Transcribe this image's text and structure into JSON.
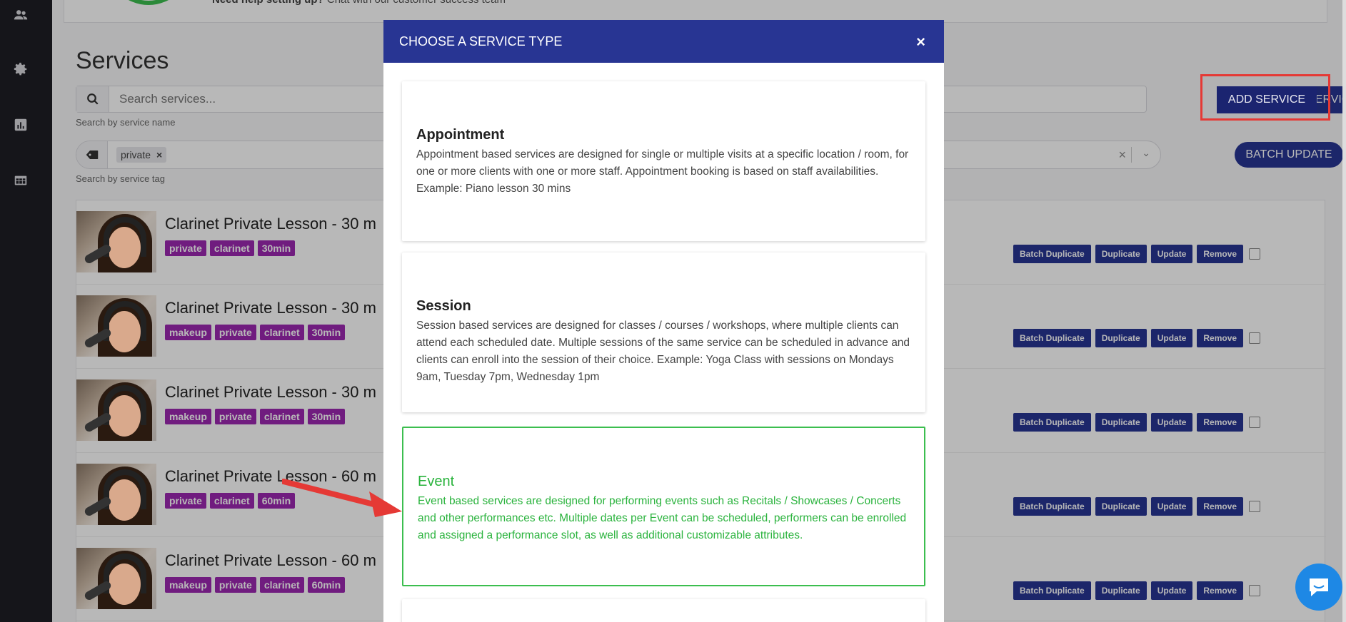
{
  "help": {
    "bold": "Need help setting up?",
    "rest": "Chat with our customer success team"
  },
  "page": {
    "title": "Services"
  },
  "search": {
    "placeholder": "Search services...",
    "hint": "Search by service name"
  },
  "tag_filter": {
    "chip": "private",
    "hint": "Search by service tag"
  },
  "buttons": {
    "add_service": "ADD SERVICE",
    "batch_update": "BATCH UPDATE"
  },
  "services": [
    {
      "title": "Clarinet Private Lesson - 30 m",
      "tags": [
        "private",
        "clarinet",
        "30min"
      ]
    },
    {
      "title": "Clarinet Private Lesson - 30 m",
      "tags": [
        "makeup",
        "private",
        "clarinet",
        "30min"
      ]
    },
    {
      "title": "Clarinet Private Lesson - 30 m",
      "tags": [
        "makeup",
        "private",
        "clarinet",
        "30min"
      ]
    },
    {
      "title": "Clarinet Private Lesson - 60 m",
      "tags": [
        "private",
        "clarinet",
        "60min"
      ]
    },
    {
      "title": "Clarinet Private Lesson - 60 m",
      "tags": [
        "makeup",
        "private",
        "clarinet",
        "60min"
      ]
    }
  ],
  "row_actions": {
    "batch_duplicate": "Batch Duplicate",
    "duplicate": "Duplicate",
    "update": "Update",
    "remove": "Remove"
  },
  "modal": {
    "title": "CHOOSE A SERVICE TYPE",
    "close": "×",
    "types": [
      {
        "name": "Appointment",
        "desc": "Appointment based services are designed for single or multiple visits at a specific location / room, for one or more clients with one or more staff. Appointment booking is based on staff availabilities. Example: Piano lesson 30 mins"
      },
      {
        "name": "Session",
        "desc": "Session based services are designed for classes / courses / workshops, where multiple clients can attend each scheduled date. Multiple sessions of the same service can be scheduled in advance and clients can enroll into the session of their choice. Example: Yoga Class with sessions on Mondays 9am, Tuesday 7pm, Wednesday 1pm"
      },
      {
        "name": "Event",
        "desc": "Event based services are designed for performing events such as Recitals / Showcases / Concerts and other performances etc. Multiple dates per Event can be scheduled, performers can be enrolled and assigned a performance slot, as well as additional customizable attributes."
      }
    ]
  },
  "colors": {
    "primary": "#283593",
    "tag": "#9c27b0",
    "active": "#3cbe4f",
    "highlight": "#e53935"
  }
}
